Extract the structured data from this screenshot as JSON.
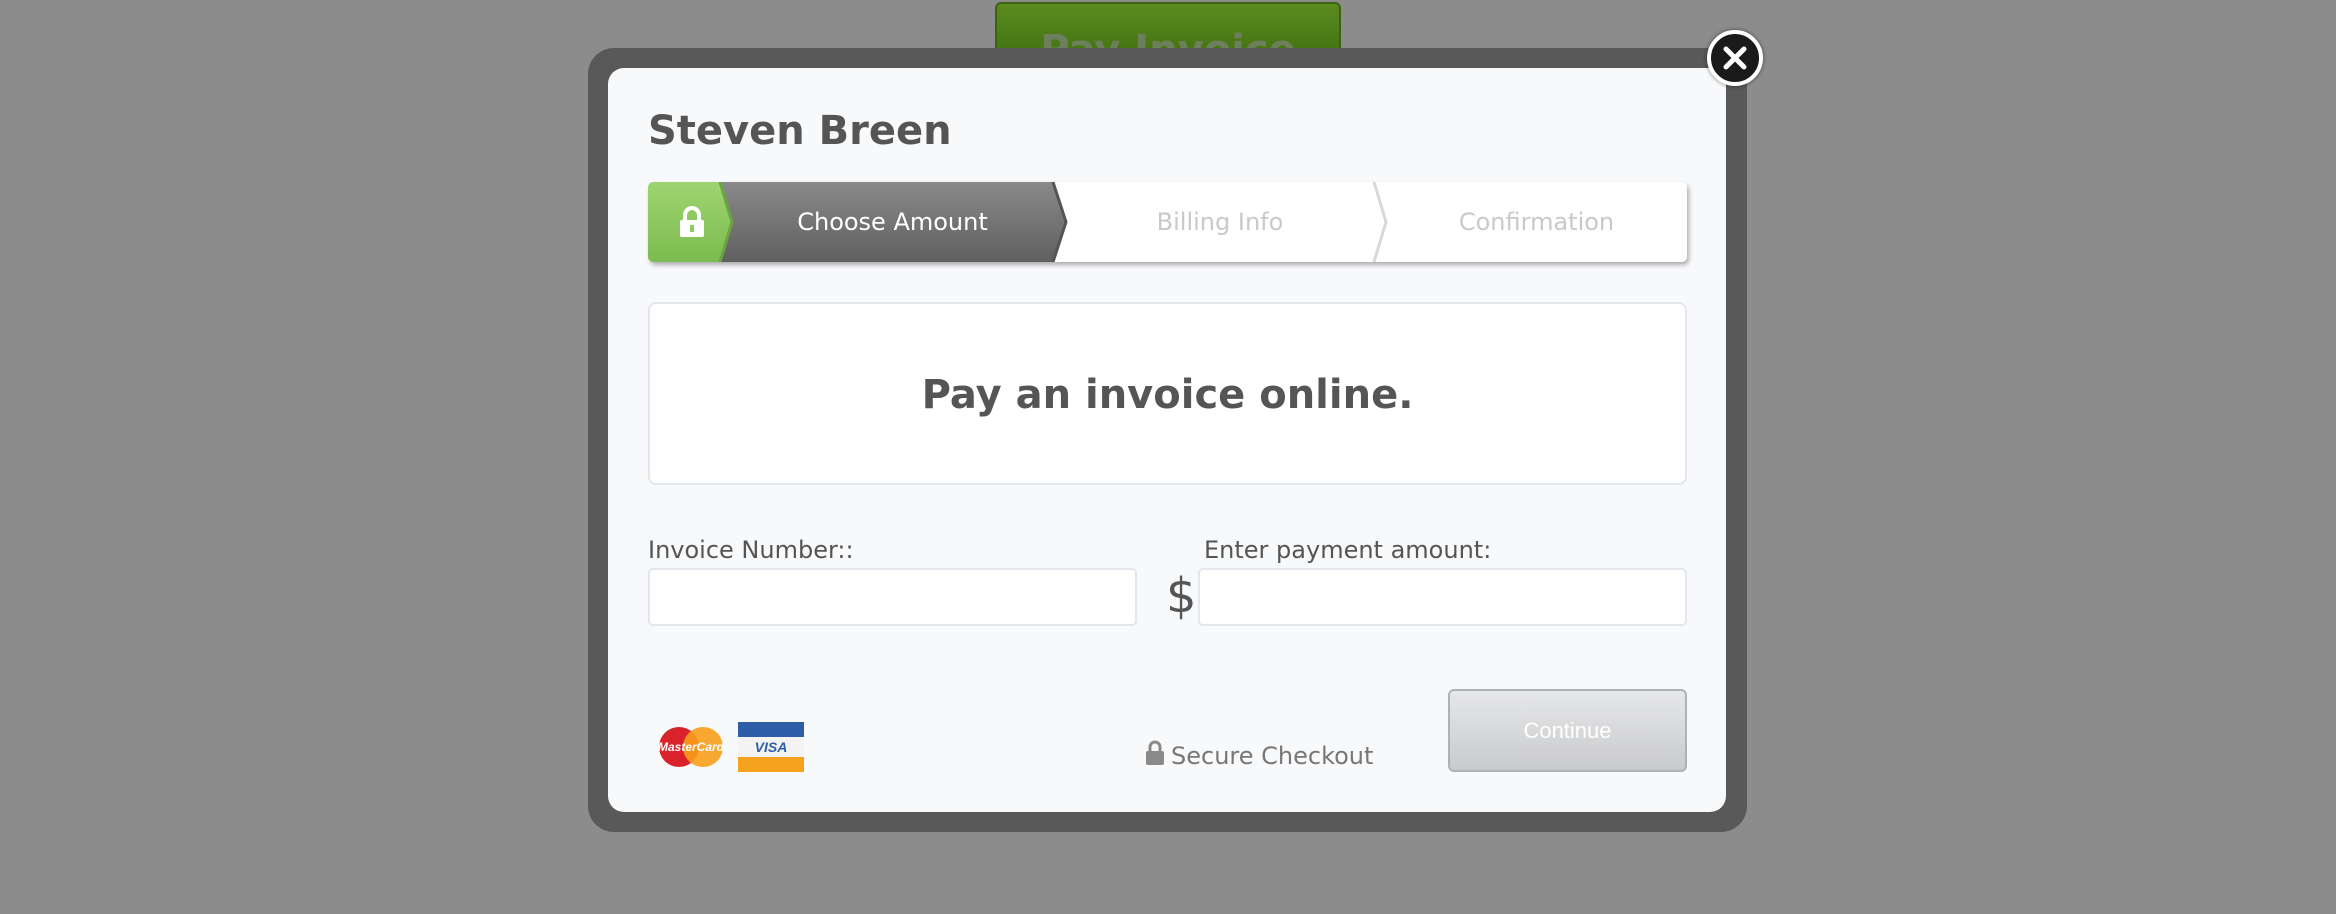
{
  "background": {
    "pay_button_label": "Pay Invoice"
  },
  "modal": {
    "payer_name": "Steven Breen",
    "steps": [
      {
        "label": "Choose Amount",
        "active": true
      },
      {
        "label": "Billing Info",
        "active": false
      },
      {
        "label": "Confirmation",
        "active": false
      }
    ],
    "banner_text": "Pay an invoice online.",
    "invoice_field": {
      "label": "Invoice Number::",
      "value": ""
    },
    "amount_field": {
      "label": "Enter payment amount:",
      "currency_symbol": "$",
      "value": ""
    },
    "cards": [
      {
        "icon": "mastercard-icon",
        "text": "MasterCard"
      },
      {
        "icon": "visa-icon",
        "text": "VISA"
      }
    ],
    "secure_text": "Secure Checkout",
    "continue_label": "Continue"
  },
  "colors": {
    "accent_green": "#8fcb63",
    "active_step": "#707070",
    "frame": "#595959",
    "overlay": "#8c8c8c"
  }
}
